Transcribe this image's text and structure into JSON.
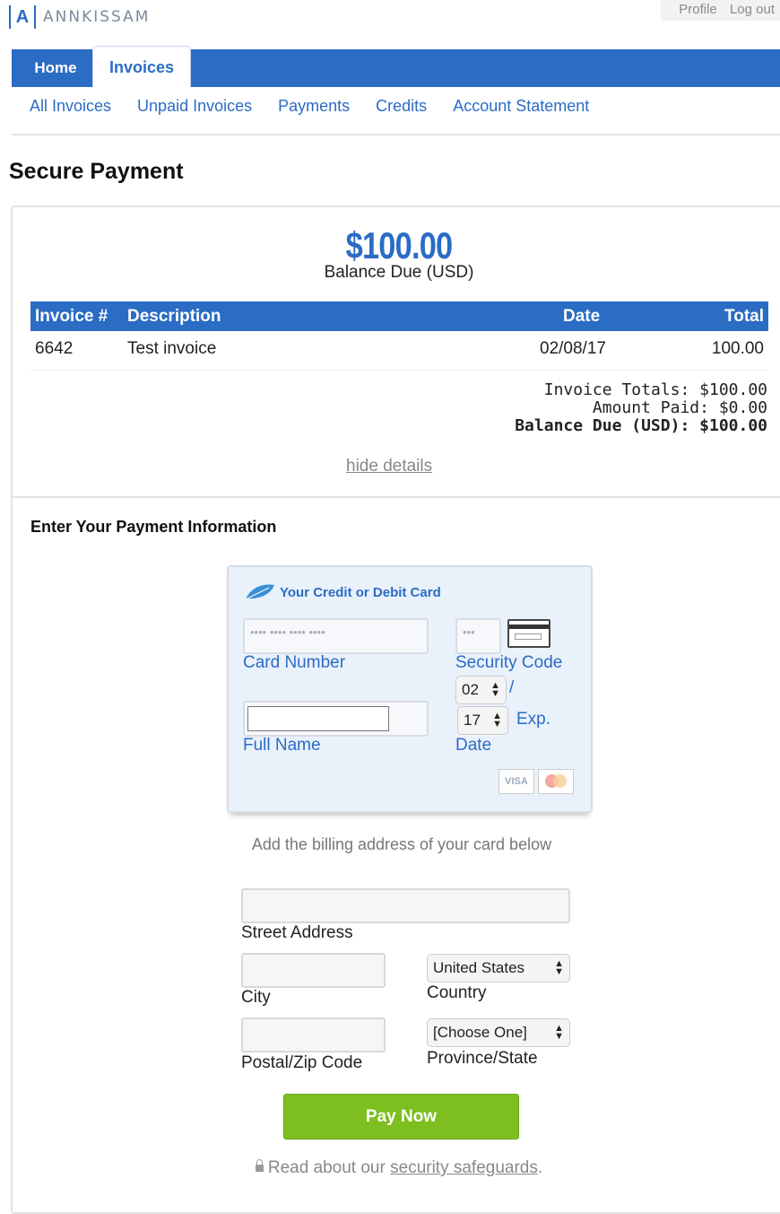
{
  "brand": {
    "name": "ANNKISSAM",
    "logo_letter": "A"
  },
  "toplinks": [
    "Profile",
    "Log out"
  ],
  "nav": {
    "tabs": [
      {
        "label": "Home"
      },
      {
        "label": "Invoices"
      }
    ]
  },
  "subnav": [
    "All Invoices",
    "Unpaid Invoices",
    "Payments",
    "Credits",
    "Account Statement"
  ],
  "page": {
    "title": "Secure Payment"
  },
  "summary": {
    "amount": "$100.00",
    "label": "Balance Due (USD)"
  },
  "invoice_table": {
    "headers": [
      "Invoice #",
      "Description",
      "Date",
      "Total"
    ],
    "rows": [
      {
        "number": "6642",
        "description": "Test invoice",
        "date": "02/08/17",
        "total": "100.00"
      }
    ]
  },
  "totals": {
    "invoice_totals_label": "Invoice Totals:",
    "invoice_totals_value": "$100.00",
    "amount_paid_label": "Amount Paid:",
    "amount_paid_value": "$0.00",
    "balance_due_label": "Balance Due (USD):",
    "balance_due_value": "$100.00"
  },
  "hide_details": "hide details",
  "payment": {
    "heading": "Enter Your Payment Information",
    "card_title": "Your Credit or Debit Card",
    "card_number_placeholder": "•••• •••• •••• ••••",
    "card_number_label": "Card Number",
    "security_code_placeholder": "•••",
    "security_code_label": "Security Code",
    "exp_month": "02",
    "exp_separator": "/",
    "exp_year": "17",
    "exp_label_1": "Exp.",
    "exp_label_2": "Date",
    "full_name_label": "Full Name",
    "full_name_value": "",
    "card_brands": [
      "VISA",
      "MasterCard"
    ]
  },
  "billing": {
    "note": "Add the billing address of your card below",
    "street_label": "Street Address",
    "city_label": "City",
    "country_label": "Country",
    "country_value": "United States",
    "postal_label": "Postal/Zip Code",
    "province_label": "Province/State",
    "province_value": "[Choose One]"
  },
  "pay_button": "Pay Now",
  "security": {
    "prefix": "Read about our",
    "link": "security safeguards",
    "suffix": "."
  },
  "colors": {
    "accent": "#2b6cc4",
    "pay_button": "#7cbf1e"
  }
}
